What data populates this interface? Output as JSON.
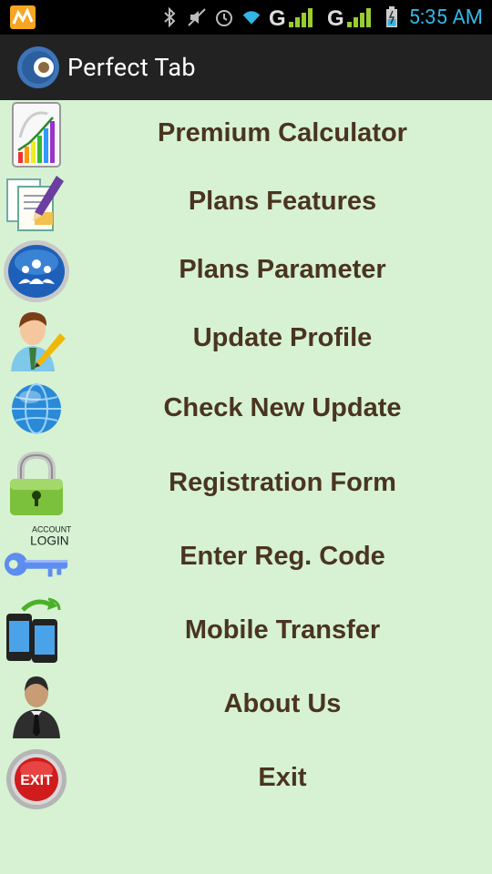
{
  "status_bar": {
    "time": "5:35 AM",
    "icons": [
      "notification-app-icon",
      "bluetooth-icon",
      "mute-icon",
      "alarm-icon",
      "wifi-icon",
      "signal-g-icon",
      "signal-g2-icon",
      "battery-icon"
    ]
  },
  "header": {
    "title": "Perfect Tab",
    "logo": "perfect-tab-logo"
  },
  "menu": {
    "items": [
      {
        "label": "Premium Calculator",
        "icon": "chart-calculator-icon"
      },
      {
        "label": "Plans Features",
        "icon": "documents-pencil-icon"
      },
      {
        "label": "Plans Parameter",
        "icon": "people-globe-icon"
      },
      {
        "label": "Update Profile",
        "icon": "user-pencil-icon"
      },
      {
        "label": "Check New Update",
        "icon": "globe-icon"
      },
      {
        "label": "Registration Form",
        "icon": "padlock-icon"
      },
      {
        "label": "Enter Reg. Code",
        "icon": "account-login-key-icon",
        "icon_text": [
          "ACCOUNT",
          "LOGIN"
        ]
      },
      {
        "label": "Mobile Transfer",
        "icon": "phone-transfer-icon"
      },
      {
        "label": "About Us",
        "icon": "businessman-icon"
      },
      {
        "label": "Exit",
        "icon": "exit-button-icon",
        "icon_text": "EXIT"
      }
    ]
  },
  "colors": {
    "background": "#d6f2d3",
    "label": "#4a3420",
    "action_bar": "#222222",
    "status_accent": "#33b5e5"
  }
}
